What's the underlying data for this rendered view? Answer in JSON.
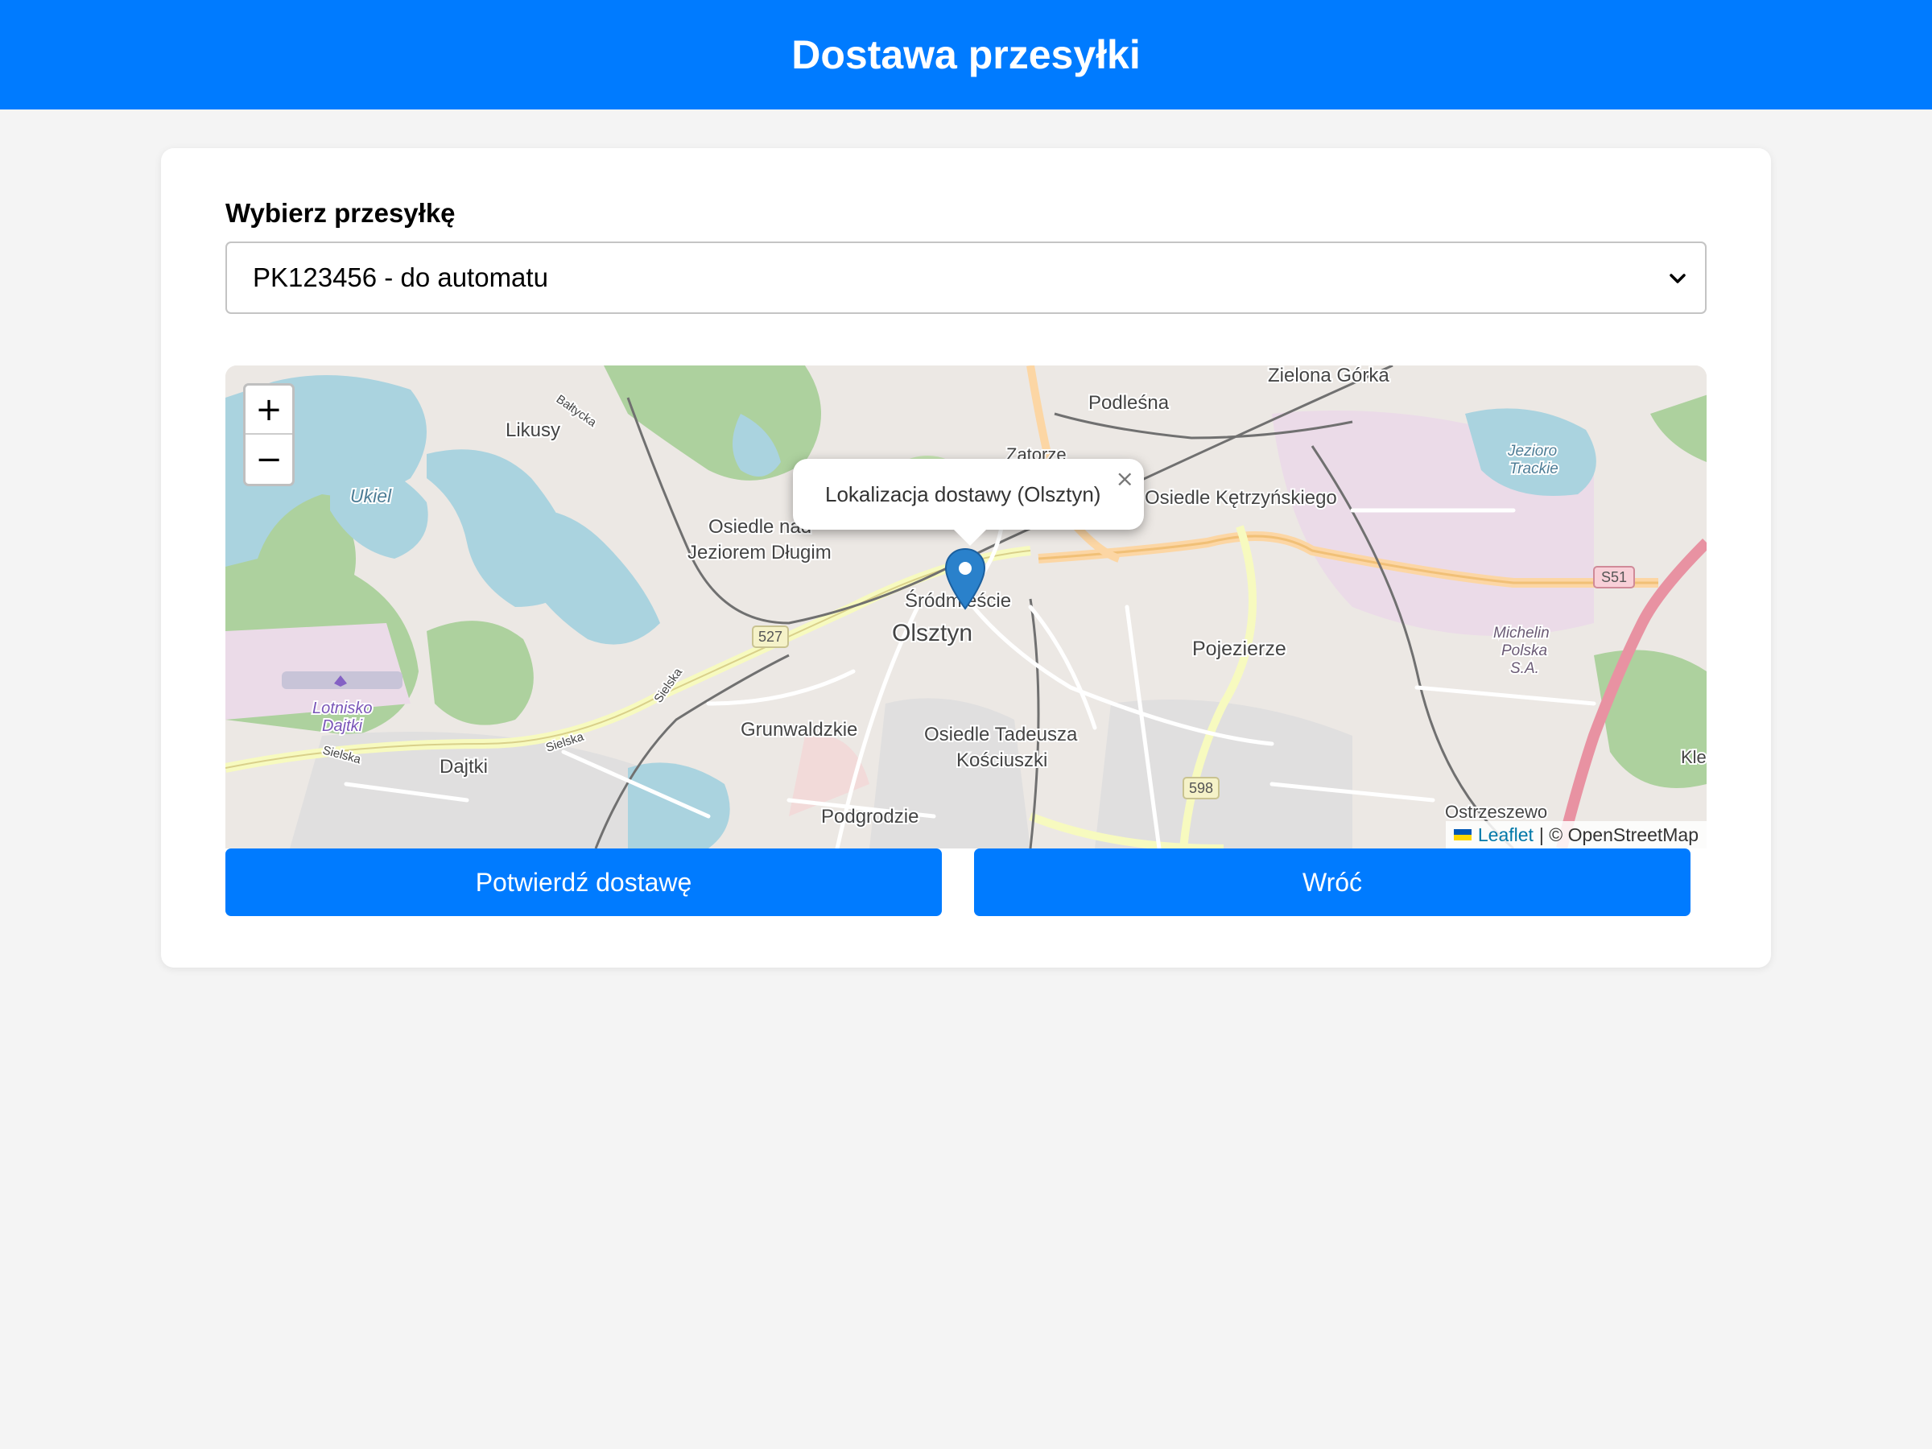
{
  "header": {
    "title": "Dostawa przesyłki"
  },
  "form": {
    "label": "Wybierz przesyłkę",
    "selected_option": "PK123456 - do automatu"
  },
  "map": {
    "zoom_in_label": "+",
    "zoom_out_label": "−",
    "popup_text": "Lokalizacja dostawy (Olsztyn)",
    "popup_close": "×",
    "attribution_link": "Leaflet",
    "attribution_text": "| © OpenStreetMap",
    "place_labels": {
      "zielona_gorka": "Zielona Górka",
      "podlesna": "Podleśna",
      "likusy": "Likusy",
      "ukiel": "Ukiel",
      "zatorze": "Zatorze",
      "osiedle_ketrzynskiego": "Osiedle Kętrzyńskiego",
      "jezioro_trackie_1": "Jezioro",
      "jezioro_trackie_2": "Trackie",
      "osiedle_nad_1": "Osiedle nad",
      "osiedle_nad_2": "Jeziorem Długim",
      "srodmiescie": "Śródmieście",
      "olsztyn": "Olsztyn",
      "pojezierze": "Pojezierze",
      "michelin_1": "Michelin",
      "michelin_2": "Polska",
      "michelin_3": "S.A.",
      "lotnisko_1": "Lotnisko",
      "lotnisko_2": "Dajtki",
      "grunwaldzkie": "Grunwaldzkie",
      "tadeusza_1": "Osiedle Tadeusza",
      "tadeusza_2": "Kościuszki",
      "dajtki": "Dajtki",
      "podgrodzie": "Podgrodzie",
      "ostrzeszewo": "Ostrzeszewo",
      "kle": "Kle",
      "baltycka": "Bałtycka",
      "sielska_1": "Sielska",
      "sielska_2": "Sielska",
      "sielska_3": "Sielska",
      "road_527": "527",
      "road_598": "598",
      "road_s51": "S51"
    }
  },
  "actions": {
    "confirm_label": "Potwierdź dostawę",
    "back_label": "Wróć"
  },
  "colors": {
    "primary": "#007bff",
    "water": "#aad3df",
    "forest": "#add19e",
    "marker": "#2a81cb"
  }
}
